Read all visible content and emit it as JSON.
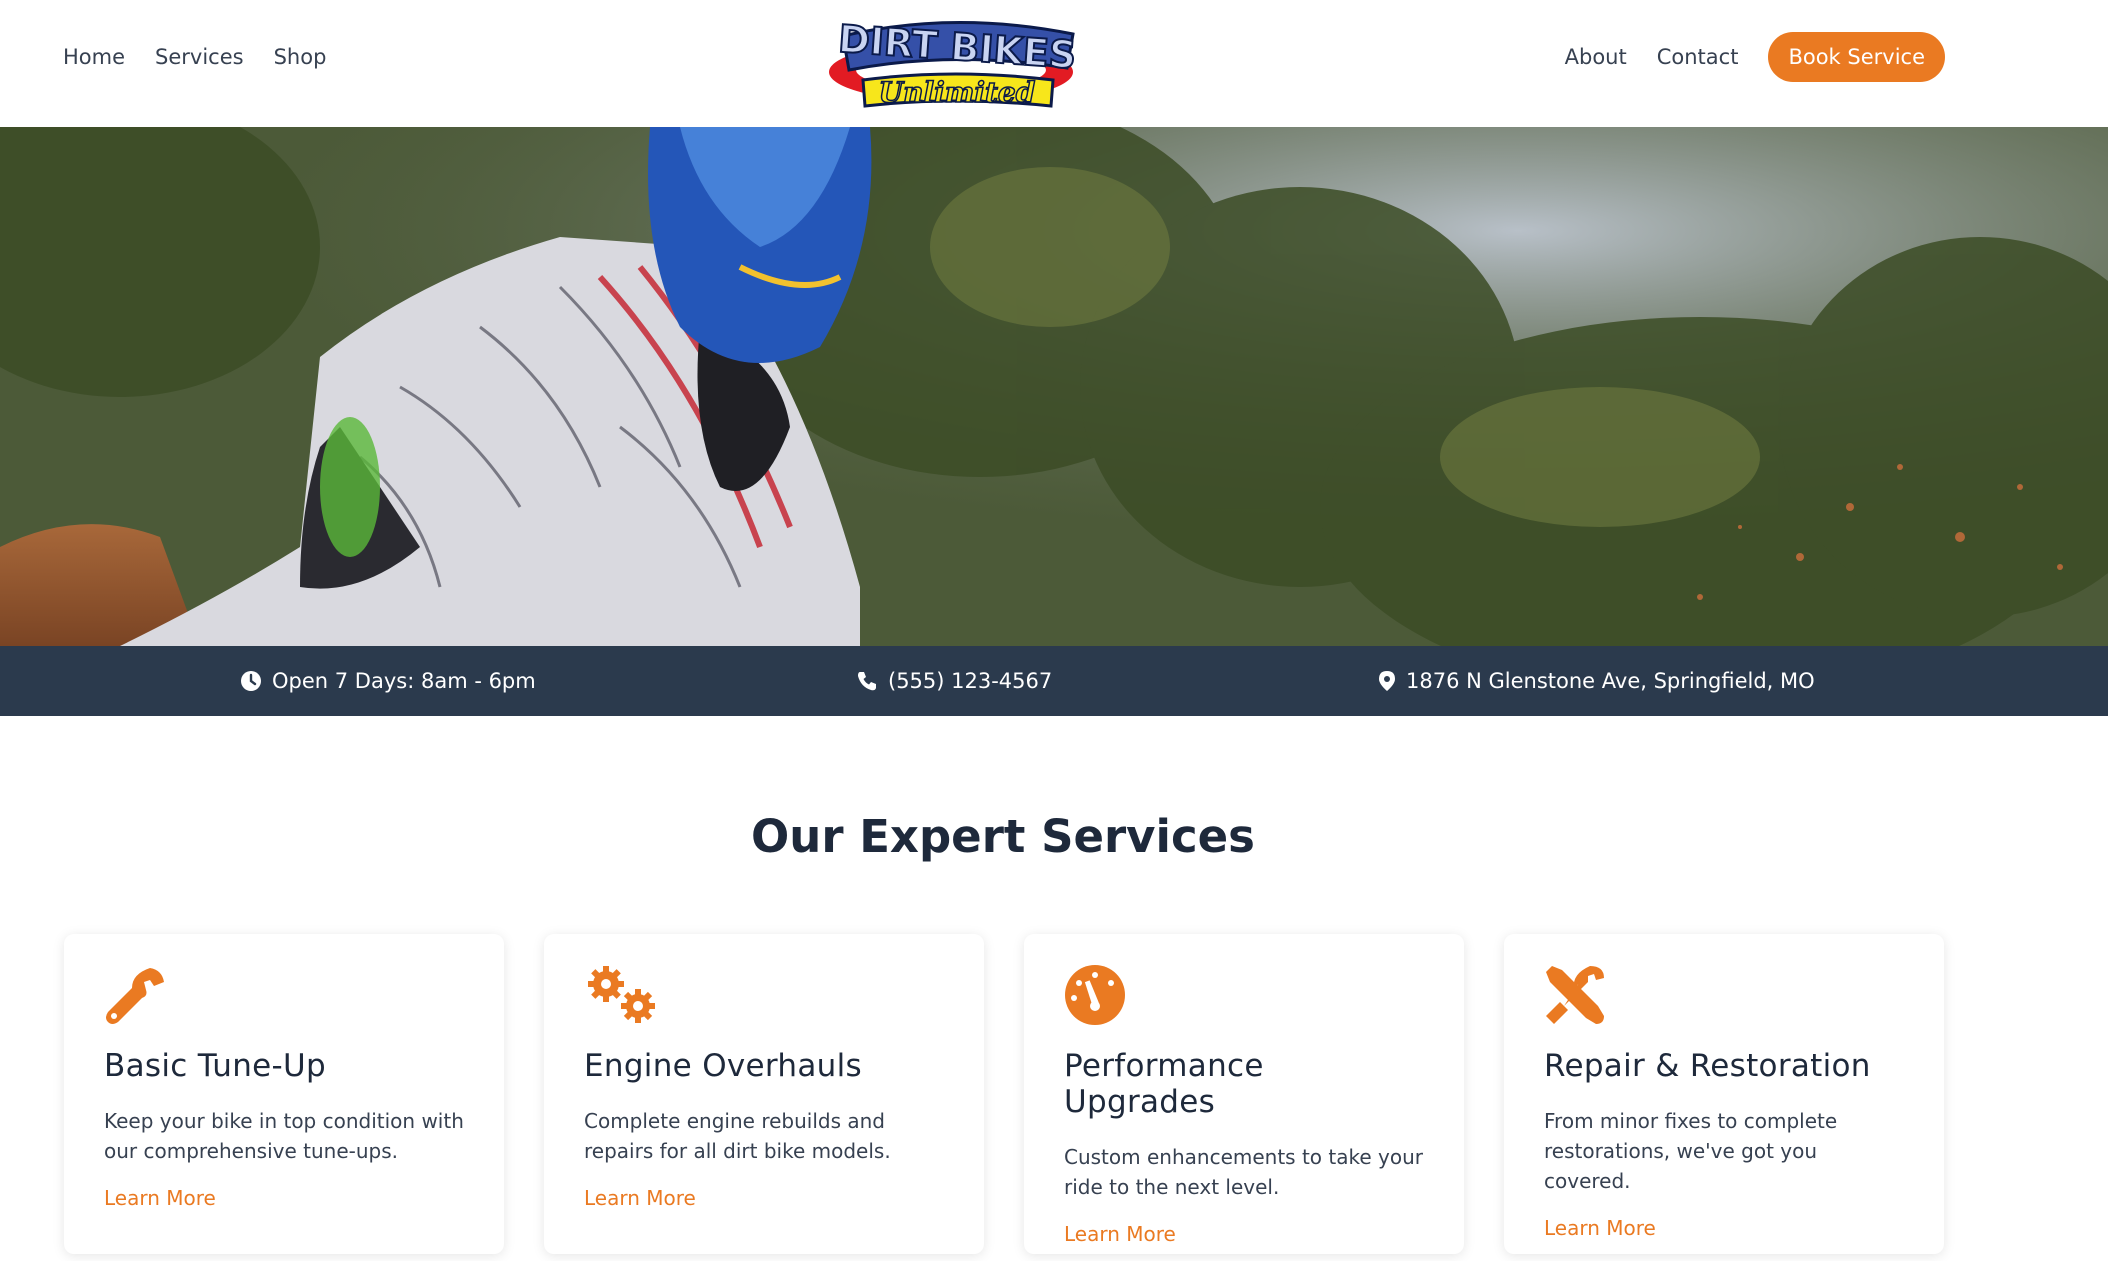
{
  "header": {
    "nav_left": [
      "Home",
      "Services",
      "Shop"
    ],
    "nav_right": [
      "About",
      "Contact"
    ],
    "book_label": "Book Service",
    "logo_top": "DIRT BIKES",
    "logo_bottom": "Unlimited"
  },
  "info": {
    "hours": "Open 7 Days: 8am - 6pm",
    "phone": "(555) 123-4567",
    "address": "1876 N Glenstone Ave, Springfield, MO"
  },
  "services": {
    "title": "Our Expert Services",
    "cards": [
      {
        "icon": "wrench-icon",
        "title": "Basic Tune-Up",
        "desc": "Keep your bike in top condition with our comprehensive tune-ups.",
        "link": "Learn More"
      },
      {
        "icon": "gears-icon",
        "title": "Engine Overhauls",
        "desc": "Complete engine rebuilds and repairs for all dirt bike models.",
        "link": "Learn More"
      },
      {
        "icon": "gauge-icon",
        "title": "Performance Upgrades",
        "desc": "Custom enhancements to take your ride to the next level.",
        "link": "Learn More"
      },
      {
        "icon": "tools-icon",
        "title": "Repair & Restoration",
        "desc": "From minor fixes to complete restorations, we've got you covered.",
        "link": "Learn More"
      }
    ]
  },
  "colors": {
    "accent": "#ea7a22",
    "info_bar": "#2b3a4d",
    "heading": "#1e293b"
  }
}
